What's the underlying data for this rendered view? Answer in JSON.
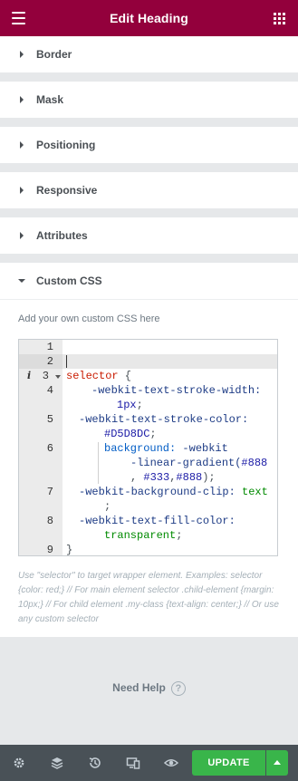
{
  "header": {
    "title": "Edit Heading",
    "menu_icon": "hamburger-icon",
    "apps_icon": "grid-icon"
  },
  "sections": [
    {
      "label": "Border"
    },
    {
      "label": "Mask"
    },
    {
      "label": "Positioning"
    },
    {
      "label": "Responsive"
    },
    {
      "label": "Attributes"
    }
  ],
  "custom_css": {
    "label": "Custom CSS",
    "help": "Add your own custom CSS here",
    "line_numbers": [
      "1",
      "2",
      "3",
      "4",
      "5",
      "6",
      "7",
      "8",
      "9"
    ],
    "info_marker": "i",
    "code": {
      "l3_selector": "selector",
      "l3_brace": " {",
      "l4_prop": "-webkit-text-stroke-width:",
      "l4_val": "1px",
      "l4_semi": ";",
      "l5_prop": "-webkit-text-stroke-color:",
      "l5_val": "#D5D8DC",
      "l5_semi": ";",
      "l6_prop": "background:",
      "l6_fn1": " -webkit",
      "l6_fn2": "-linear-gradient(",
      "l6_v1": "#888",
      "l6_comma1": ", ",
      "l6_v2": "#333",
      "l6_comma2": ",",
      "l6_v3": "#888",
      "l6_end": ");",
      "l7_prop": "-webkit-background-clip:",
      "l7_val": " text",
      "l7_semi": ";",
      "l8_prop": "-webkit-text-fill-color:",
      "l8_val": "transparent",
      "l8_semi": ";",
      "l9_brace": "}"
    },
    "note": "Use \"selector\" to target wrapper element. Examples: selector {color: red;} // For main element selector .child-element {margin: 10px;} // For child element .my-class {text-align: center;} // Or use any custom selector"
  },
  "need_help": {
    "label": "Need Help",
    "icon": "?"
  },
  "footer": {
    "icons": [
      "settings-icon",
      "layers-icon",
      "history-icon",
      "responsive-icon",
      "preview-icon"
    ],
    "update_label": "UPDATE"
  }
}
